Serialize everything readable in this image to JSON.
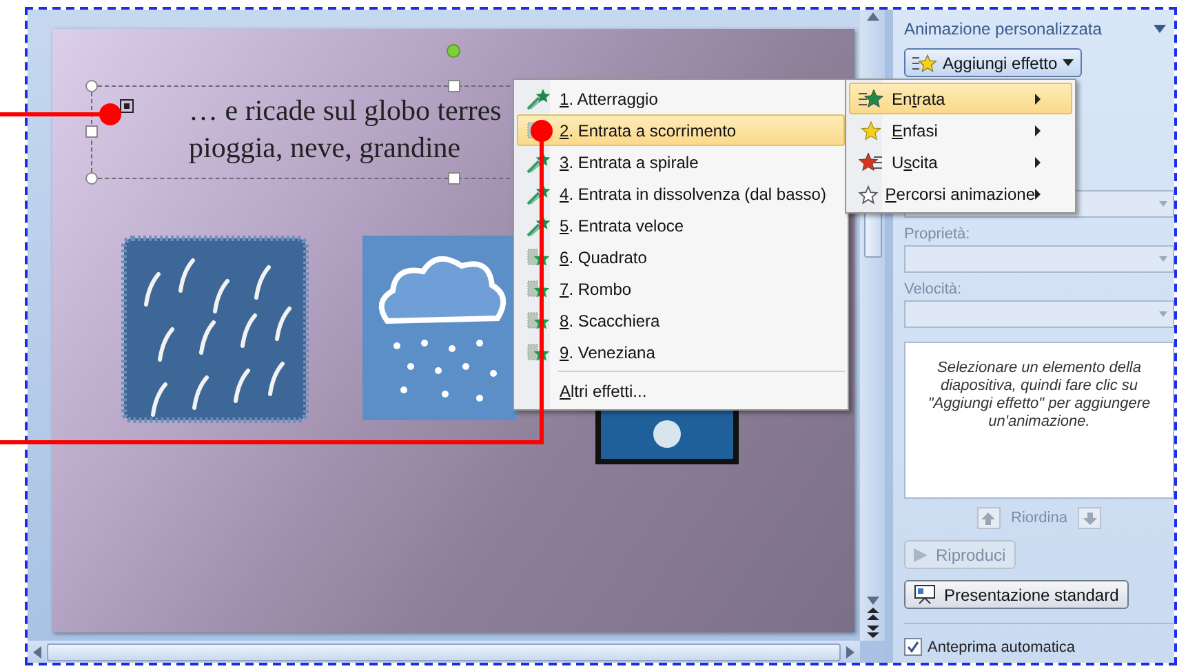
{
  "slide": {
    "text_lines": [
      "… e ricade sul globo terres",
      "pioggia, neve, grandine"
    ]
  },
  "effects_menu": {
    "items": [
      {
        "key": "1",
        "post": ". Atterraggio",
        "kind": "streak",
        "selected": false
      },
      {
        "key": "2",
        "post": ". Entrata a scorrimento",
        "kind": "pattern",
        "selected": true
      },
      {
        "key": "3",
        "post": ". Entrata a spirale",
        "kind": "streak",
        "selected": false
      },
      {
        "key": "4",
        "post": ". Entrata in dissolvenza (dal basso)",
        "kind": "streak",
        "selected": false
      },
      {
        "key": "5",
        "post": ". Entrata veloce",
        "kind": "streak",
        "selected": false
      },
      {
        "key": "6",
        "post": ". Quadrato",
        "kind": "pattern",
        "selected": false
      },
      {
        "key": "7",
        "post": ". Rombo",
        "kind": "pattern",
        "selected": false
      },
      {
        "key": "8",
        "post": ". Scacchiera",
        "kind": "pattern",
        "selected": false
      },
      {
        "key": "9",
        "post": ". Veneziana",
        "kind": "pattern",
        "selected": false
      }
    ],
    "more": {
      "key": "A",
      "post": "ltri effetti..."
    }
  },
  "add_effect_menu": {
    "items": [
      {
        "pre": "En",
        "key": "t",
        "post": "rata",
        "kind": "entrance",
        "selected": true
      },
      {
        "key": "E",
        "post": "nfasi",
        "kind": "emphasis",
        "selected": false
      },
      {
        "pre": "U",
        "key": "s",
        "post": "cita",
        "kind": "exit",
        "selected": false
      },
      {
        "key": "P",
        "post": "ercorsi animazione",
        "kind": "path",
        "selected": false
      }
    ]
  },
  "task_pane": {
    "title": "Animazione personalizzata",
    "add_effect_button": "Aggiungi effetto",
    "fields": [
      {
        "label": "Proprietà:",
        "disabled": true
      },
      {
        "label": "Velocità:",
        "disabled": true
      }
    ],
    "hint": "Selezionare un elemento della diapositiva, quindi fare clic su \"Aggiungi effetto\" per aggiungere un'animazione.",
    "reorder_label": "Riordina",
    "play_button": {
      "label": "Riproduci",
      "disabled": true
    },
    "slideshow_button": "Presentazione standard",
    "autopreview": {
      "label": "Anteprima automatica",
      "checked": true
    }
  }
}
